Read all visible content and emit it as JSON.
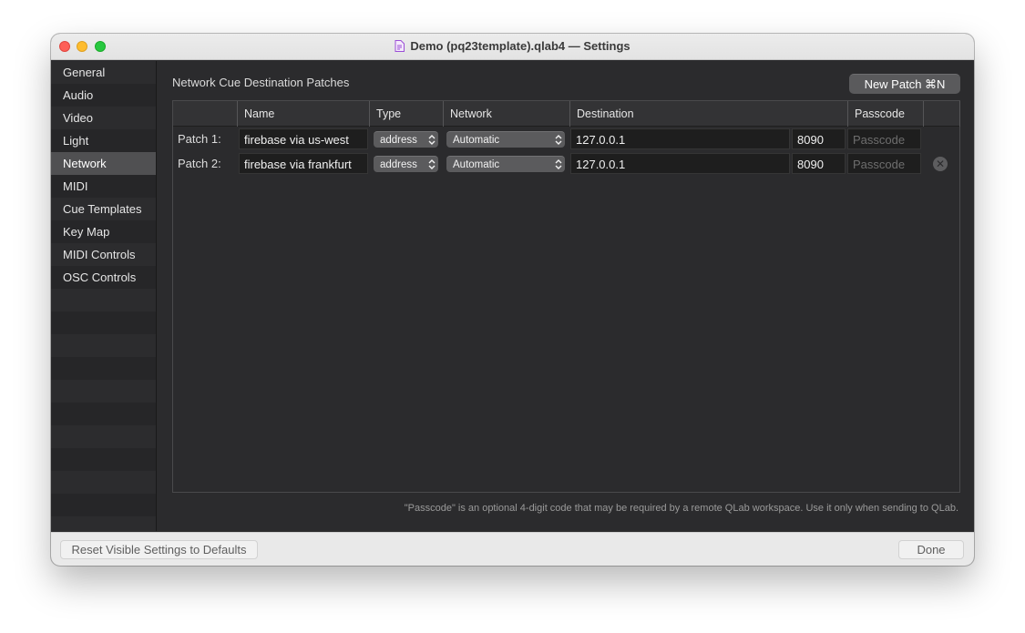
{
  "window": {
    "title": "Demo (pq23template).qlab4 — Settings"
  },
  "sidebar": {
    "items": [
      {
        "label": "General"
      },
      {
        "label": "Audio"
      },
      {
        "label": "Video"
      },
      {
        "label": "Light"
      },
      {
        "label": "Network",
        "selected": true
      },
      {
        "label": "MIDI"
      },
      {
        "label": "Cue Templates"
      },
      {
        "label": "Key Map"
      },
      {
        "label": "MIDI Controls"
      },
      {
        "label": "OSC Controls"
      }
    ]
  },
  "main": {
    "section_title": "Network Cue Destination Patches",
    "new_patch_label": "New Patch ⌘N",
    "columns": {
      "name": "Name",
      "type": "Type",
      "network": "Network",
      "destination": "Destination",
      "passcode": "Passcode"
    },
    "patches": [
      {
        "label": "Patch 1:",
        "name": "firebase via us-west",
        "type": "address",
        "network": "Automatic",
        "destination": "127.0.0.1",
        "port": "8090",
        "passcode_placeholder": "Passcode"
      },
      {
        "label": "Patch 2:",
        "name": "firebase via frankfurt",
        "type": "address",
        "network": "Automatic",
        "destination": "127.0.0.1",
        "port": "8090",
        "passcode_placeholder": "Passcode"
      }
    ],
    "footnote": "\"Passcode\" is an optional 4-digit code that may be required by a remote QLab workspace. Use it only when sending to QLab."
  },
  "bottom": {
    "reset_label": "Reset Visible Settings to Defaults",
    "done_label": "Done"
  },
  "colors": {
    "accent_close": "#fe5f57",
    "accent_min": "#febc2e",
    "accent_max": "#28c840",
    "panel": "#2b2b2d",
    "selected_row": "#505052"
  }
}
